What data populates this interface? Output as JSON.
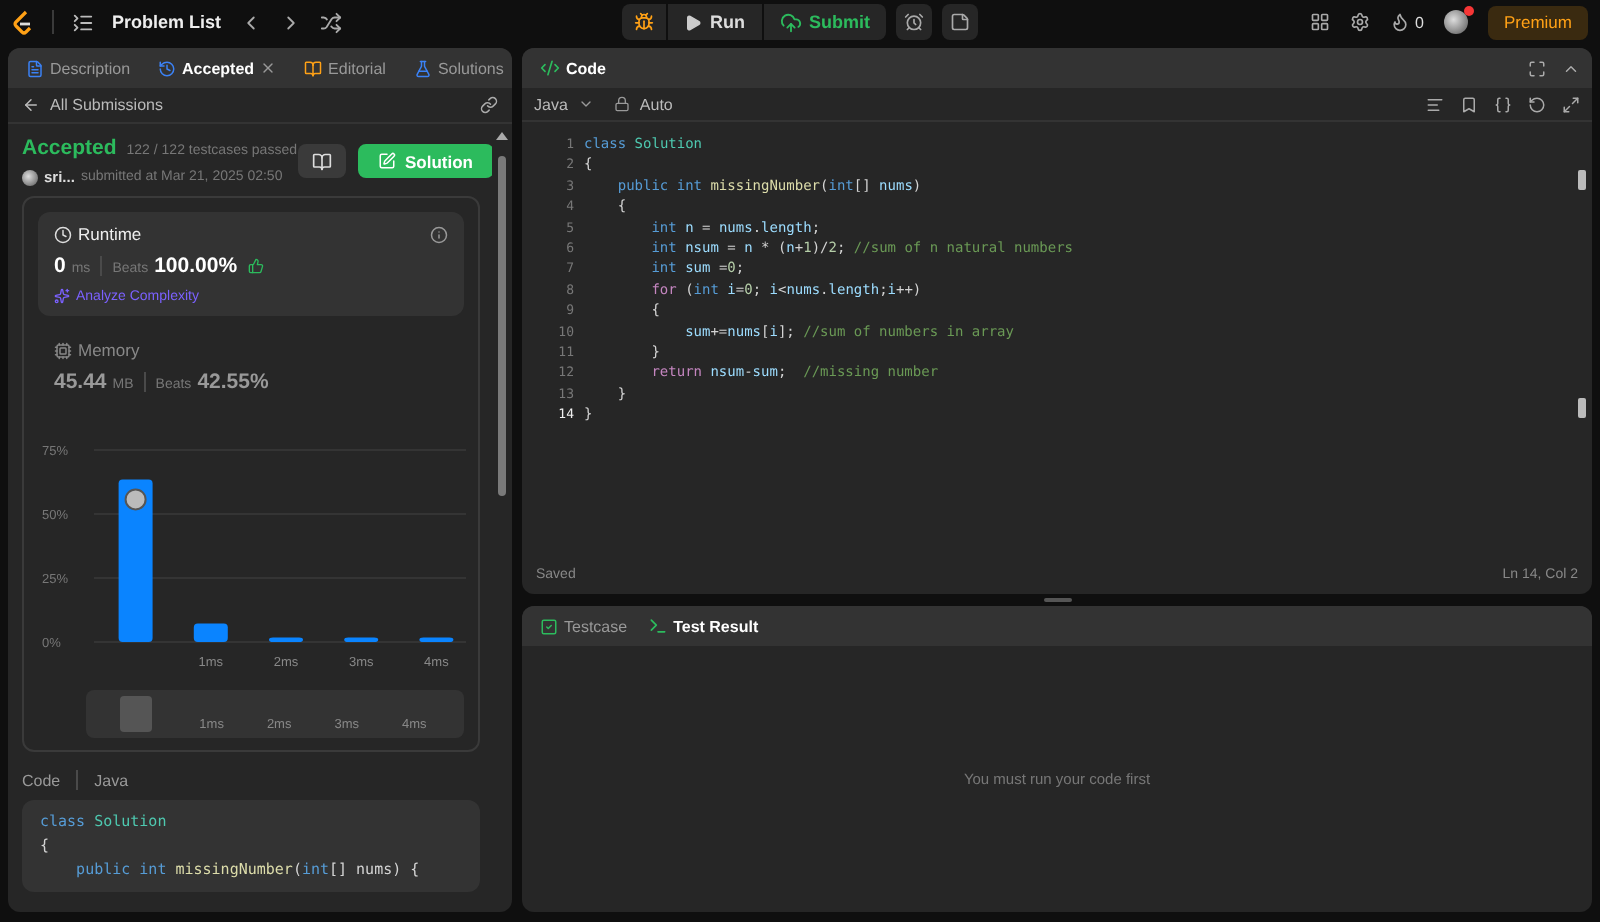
{
  "top_bar": {
    "title": "Problem List",
    "run": "Run",
    "submit": "Submit",
    "streak": "0",
    "premium": "Premium",
    "notification": true
  },
  "left_tabs": [
    {
      "label": "Description",
      "selected": false,
      "closable": false
    },
    {
      "label": "Accepted",
      "selected": true,
      "closable": true
    },
    {
      "label": "Editorial",
      "selected": false,
      "closable": false
    },
    {
      "label": "Solutions",
      "selected": false,
      "closable": false
    }
  ],
  "submission": {
    "back": "All Submissions",
    "status": "Accepted",
    "testcases": "122 / 122 testcases passed",
    "user": "sri...",
    "submitted": "submitted at Mar 21, 2025 02:50",
    "solution_button": "Solution"
  },
  "stats": [
    {
      "kind": "runtime",
      "title": "Runtime",
      "value": "0",
      "unit": "ms",
      "beats_label": "Beats",
      "beats": "100.00%",
      "analyze": "Analyze Complexity",
      "selected": true
    },
    {
      "kind": "memory",
      "title": "Memory",
      "value": "45.44",
      "unit": "MB",
      "beats_label": "Beats",
      "beats": "42.55%",
      "selected": false
    }
  ],
  "chart_data": {
    "type": "bar",
    "categories": [
      null,
      "1ms",
      "2ms",
      "3ms",
      "4ms"
    ],
    "values": [
      63.5,
      7.2,
      1.8,
      1.8,
      1.8
    ],
    "ylim": [
      0,
      75
    ],
    "yticks": [
      {
        "value": 0,
        "label": "0%"
      },
      {
        "value": 25,
        "label": "25%"
      },
      {
        "value": 50,
        "label": "50%"
      },
      {
        "value": 75,
        "label": "75%"
      }
    ]
  },
  "navigator_labels": [
    "1ms",
    "2ms",
    "3ms",
    "4ms"
  ],
  "submitted_code": {
    "label": "Code",
    "language": "Java",
    "lines": [
      {
        "segments": [
          {
            "kind": "keyword",
            "text": "class "
          },
          {
            "kind": "type",
            "text": "Solution"
          }
        ]
      },
      {
        "segments": [
          {
            "kind": "plain",
            "text": "{"
          }
        ]
      },
      {
        "segments": [
          {
            "kind": "keyword",
            "text": "    public int "
          },
          {
            "kind": "function",
            "text": "missingNumber"
          },
          {
            "kind": "plain",
            "text": "("
          },
          {
            "kind": "keyword",
            "text": "int"
          },
          {
            "kind": "plain",
            "text": "[] nums) {"
          }
        ]
      }
    ]
  },
  "editor": {
    "title": "Code",
    "language": "Java",
    "mode": "Auto",
    "status": "Saved",
    "cursor": "Ln 14, Col 2",
    "lines": [
      {
        "number": "1",
        "current": false,
        "segments": [
          {
            "kind": "keyword",
            "text": "class "
          },
          {
            "kind": "type",
            "text": "Solution"
          }
        ]
      },
      {
        "number": "2",
        "current": false,
        "segments": [
          {
            "kind": "plain",
            "text": "{"
          }
        ]
      },
      {
        "number": "3",
        "current": false,
        "segments": [
          {
            "kind": "keyword",
            "text": "    public int "
          },
          {
            "kind": "function",
            "text": "missingNumber"
          },
          {
            "kind": "plain",
            "text": "("
          },
          {
            "kind": "keyword",
            "text": "int"
          },
          {
            "kind": "plain",
            "text": "[] "
          },
          {
            "kind": "variable",
            "text": "nums"
          },
          {
            "kind": "plain",
            "text": ")"
          }
        ]
      },
      {
        "number": "4",
        "current": false,
        "segments": [
          {
            "kind": "plain",
            "text": "    {"
          }
        ]
      },
      {
        "number": "5",
        "current": false,
        "segments": [
          {
            "kind": "keyword",
            "text": "        int "
          },
          {
            "kind": "variable",
            "text": "n"
          },
          {
            "kind": "plain",
            "text": " = "
          },
          {
            "kind": "variable",
            "text": "nums"
          },
          {
            "kind": "plain",
            "text": "."
          },
          {
            "kind": "variable",
            "text": "length"
          },
          {
            "kind": "plain",
            "text": ";"
          }
        ]
      },
      {
        "number": "6",
        "current": false,
        "segments": [
          {
            "kind": "keyword",
            "text": "        int "
          },
          {
            "kind": "variable",
            "text": "nsum"
          },
          {
            "kind": "plain",
            "text": " = "
          },
          {
            "kind": "variable",
            "text": "n"
          },
          {
            "kind": "plain",
            "text": " * ("
          },
          {
            "kind": "variable",
            "text": "n"
          },
          {
            "kind": "plain",
            "text": "+"
          },
          {
            "kind": "number",
            "text": "1"
          },
          {
            "kind": "plain",
            "text": ")/"
          },
          {
            "kind": "number",
            "text": "2"
          },
          {
            "kind": "plain",
            "text": "; "
          },
          {
            "kind": "comment",
            "text": "//sum of n natural numbers"
          }
        ]
      },
      {
        "number": "7",
        "current": false,
        "segments": [
          {
            "kind": "keyword",
            "text": "        int "
          },
          {
            "kind": "variable",
            "text": "sum"
          },
          {
            "kind": "plain",
            "text": " ="
          },
          {
            "kind": "number",
            "text": "0"
          },
          {
            "kind": "plain",
            "text": ";"
          }
        ]
      },
      {
        "number": "8",
        "current": false,
        "segments": [
          {
            "kind": "control",
            "text": "        for"
          },
          {
            "kind": "plain",
            "text": " ("
          },
          {
            "kind": "keyword",
            "text": "int "
          },
          {
            "kind": "variable",
            "text": "i"
          },
          {
            "kind": "plain",
            "text": "="
          },
          {
            "kind": "number",
            "text": "0"
          },
          {
            "kind": "plain",
            "text": "; "
          },
          {
            "kind": "variable",
            "text": "i"
          },
          {
            "kind": "plain",
            "text": "<"
          },
          {
            "kind": "variable",
            "text": "nums"
          },
          {
            "kind": "plain",
            "text": "."
          },
          {
            "kind": "variable",
            "text": "length"
          },
          {
            "kind": "plain",
            "text": ";"
          },
          {
            "kind": "variable",
            "text": "i"
          },
          {
            "kind": "plain",
            "text": "++)"
          }
        ]
      },
      {
        "number": "9",
        "current": false,
        "segments": [
          {
            "kind": "plain",
            "text": "        {"
          }
        ]
      },
      {
        "number": "10",
        "current": false,
        "segments": [
          {
            "kind": "variable",
            "text": "            sum"
          },
          {
            "kind": "plain",
            "text": "+="
          },
          {
            "kind": "variable",
            "text": "nums"
          },
          {
            "kind": "plain",
            "text": "["
          },
          {
            "kind": "variable",
            "text": "i"
          },
          {
            "kind": "plain",
            "text": "]; "
          },
          {
            "kind": "comment",
            "text": "//sum of numbers in array"
          }
        ]
      },
      {
        "number": "11",
        "current": false,
        "segments": [
          {
            "kind": "plain",
            "text": "        }"
          }
        ]
      },
      {
        "number": "12",
        "current": false,
        "segments": [
          {
            "kind": "control",
            "text": "        return "
          },
          {
            "kind": "variable",
            "text": "nsum"
          },
          {
            "kind": "plain",
            "text": "-"
          },
          {
            "kind": "variable",
            "text": "sum"
          },
          {
            "kind": "plain",
            "text": ";  "
          },
          {
            "kind": "comment",
            "text": "//missing number"
          }
        ]
      },
      {
        "number": "13",
        "current": false,
        "segments": [
          {
            "kind": "plain",
            "text": "    }"
          }
        ]
      },
      {
        "number": "14",
        "current": true,
        "segments": [
          {
            "kind": "plain",
            "text": "}"
          }
        ]
      }
    ]
  },
  "bottom_tabs": [
    {
      "kind": "testcase",
      "label": "Testcase",
      "selected": false
    },
    {
      "kind": "result",
      "label": "Test Result",
      "selected": true
    }
  ],
  "result_message": "You must run your code first"
}
